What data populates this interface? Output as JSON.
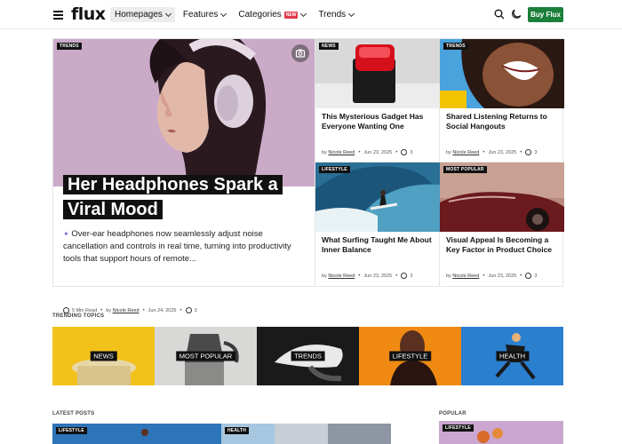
{
  "header": {
    "logo": "flux",
    "nav": [
      {
        "label": "Homepages",
        "active": true
      },
      {
        "label": "Features",
        "active": false
      },
      {
        "label": "Categories",
        "active": false,
        "badge": "NEW"
      },
      {
        "label": "Trends",
        "active": false
      }
    ],
    "buy_label": "Buy Flux",
    "buy_color": "#1a7f3a"
  },
  "hero": {
    "main": {
      "tag": "TRENDS",
      "title": "Her Headphones Spark a Viral Mood",
      "excerpt": "Over-ear headphones now seamlessly adjust noise cancellation and controls in real time, turning into productivity tools that support hours of remote...",
      "read_time": "5 Min Read",
      "author_prefix": "by",
      "author": "Nicole Reed",
      "date": "Jun 24, 2025",
      "comments": "3"
    },
    "cards": [
      {
        "tag": "NEWS",
        "title": "This Mysterious Gadget Has Everyone Wanting One",
        "author_prefix": "by",
        "author": "Nicole Reed",
        "date": "Jun 23, 2025",
        "comments": "3"
      },
      {
        "tag": "TRENDS",
        "title": "Shared Listening Returns to Social Hangouts",
        "author_prefix": "by",
        "author": "Nicole Reed",
        "date": "Jun 23, 2025",
        "comments": "3"
      },
      {
        "tag": "LIFESTYLE",
        "title": "What Surfing Taught Me About Inner Balance",
        "author_prefix": "by",
        "author": "Nicole Reed",
        "date": "Jun 23, 2025",
        "comments": "3"
      },
      {
        "tag": "MOST POPULAR",
        "title": "Visual Appeal Is Becoming a Key Factor in Product Choice",
        "author_prefix": "by",
        "author": "Nicole Reed",
        "date": "Jun 23, 2025",
        "comments": "3"
      }
    ]
  },
  "trending": {
    "label": "TRENDING TOPICS",
    "topics": [
      "NEWS",
      "MOST POPULAR",
      "TRENDS",
      "LIFESTYLE",
      "HEALTH"
    ]
  },
  "latest": {
    "label": "LATEST POSTS",
    "tags": [
      "LIFESTYLE",
      "HEALTH"
    ]
  },
  "popular": {
    "label": "POPULAR",
    "tag": "LIFESTYLE"
  }
}
